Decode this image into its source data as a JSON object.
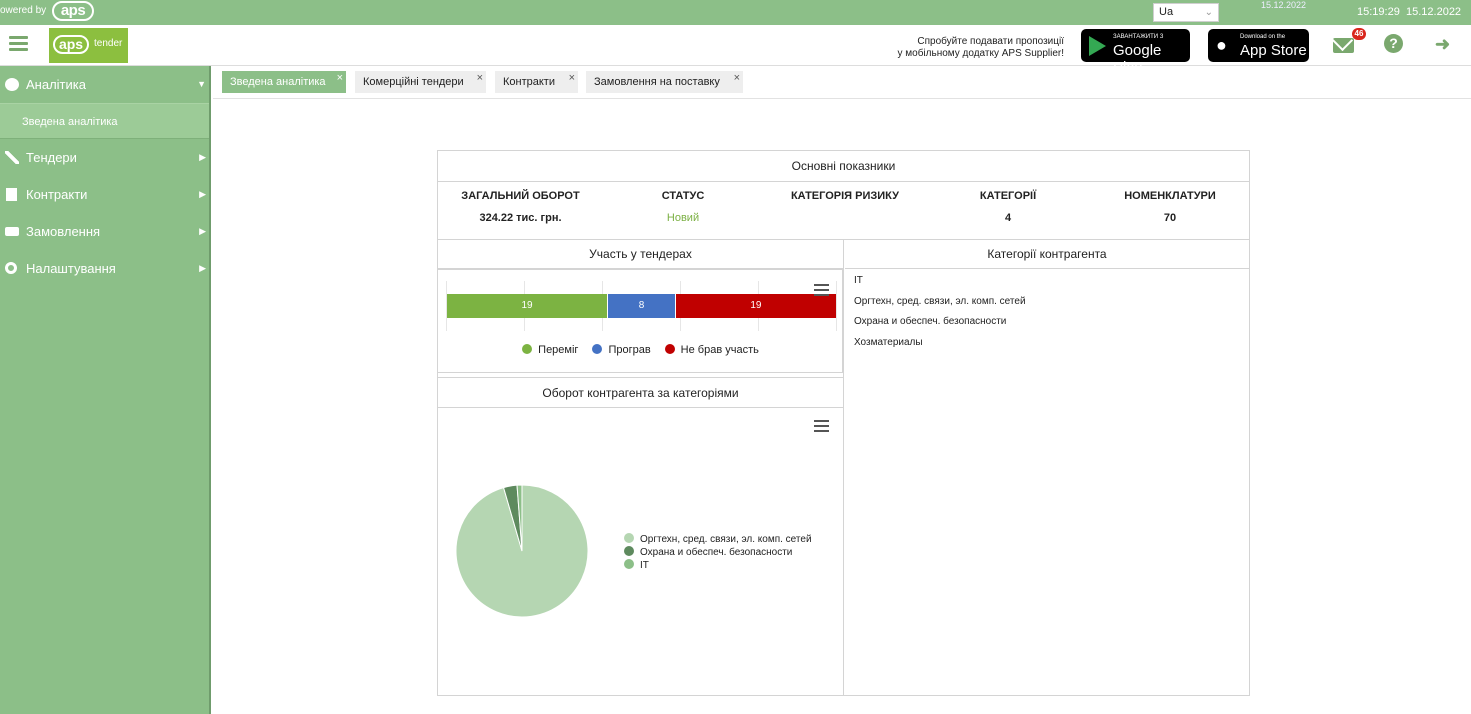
{
  "topbar": {
    "powered_by": "owered by",
    "logo": "aps",
    "language": "Ua",
    "date_small": "15.12.2022",
    "time": "15:19:29",
    "date": "15.12.2022"
  },
  "header": {
    "brand_logo": "aps",
    "brand_suffix": "tender",
    "promo_line1": "Спробуйте подавати пропозиції",
    "promo_line2": "у мобільному додатку APS Supplier!",
    "google_play_small": "ЗАВАНТАЖИТИ З",
    "google_play_big": "Google Play",
    "app_store_small": "Download on the",
    "app_store_big": "App Store",
    "mail_count": "46",
    "icons": [
      "menu-icon",
      "mail-icon",
      "help-icon",
      "logout-icon"
    ]
  },
  "sidebar": {
    "items": [
      {
        "label": "Аналітика",
        "icon": "pie-chart-icon"
      },
      {
        "label": "Тендери",
        "icon": "gavel-icon"
      },
      {
        "label": "Контракти",
        "icon": "document-icon"
      },
      {
        "label": "Замовлення",
        "icon": "truck-icon"
      },
      {
        "label": "Налаштування",
        "icon": "gears-icon"
      }
    ],
    "subitem": "Зведена аналітика"
  },
  "tabs": [
    {
      "label": "Зведена аналітика",
      "active": true
    },
    {
      "label": "Комерційні тендери",
      "active": false
    },
    {
      "label": "Контракти",
      "active": false
    },
    {
      "label": "Замовлення на поставку",
      "active": false
    }
  ],
  "dashboard": {
    "title": "Основні показники",
    "kpis": [
      {
        "label": "ЗАГАЛЬНИЙ ОБОРОТ",
        "value": "324.22 тис. грн."
      },
      {
        "label": "СТАТУС",
        "value": "Новий"
      },
      {
        "label": "КАТЕГОРІЯ РИЗИКУ",
        "value": ""
      },
      {
        "label": "КАТЕГОРІЇ",
        "value": "4"
      },
      {
        "label": "НОМЕНКЛАТУРИ",
        "value": "70"
      }
    ],
    "tender_panel_title": "Участь у тендерах",
    "turnover_panel_title": "Оборот контрагента за категоріями",
    "categories_panel_title": "Категорії контрагента",
    "categories": [
      "IT",
      "Оргтехн, сред. связи, эл. комп. сетей",
      "Охрана и обеспеч. безопасности",
      "Хозматериалы"
    ]
  },
  "chart_data": [
    {
      "type": "bar",
      "orientation": "horizontal-stacked",
      "categories": [
        ""
      ],
      "series": [
        {
          "name": "Переміг",
          "values": [
            19
          ],
          "color": "#7cb342"
        },
        {
          "name": "Програв",
          "values": [
            8
          ],
          "color": "#4472c4"
        },
        {
          "name": "Не брав участь",
          "values": [
            19
          ],
          "color": "#c00000"
        }
      ],
      "legend": "bottom",
      "grid": true
    },
    {
      "type": "pie",
      "labels": [
        "Оргтехн, сред. связи, эл. комп. сетей",
        "Охрана и обеспеч. безопасности",
        "IT"
      ],
      "values": [
        95.5,
        3.3,
        1.2
      ],
      "colors": [
        "#b5d6b2",
        "#5e8a5e",
        "#8cbf88"
      ],
      "legend": "right"
    }
  ]
}
